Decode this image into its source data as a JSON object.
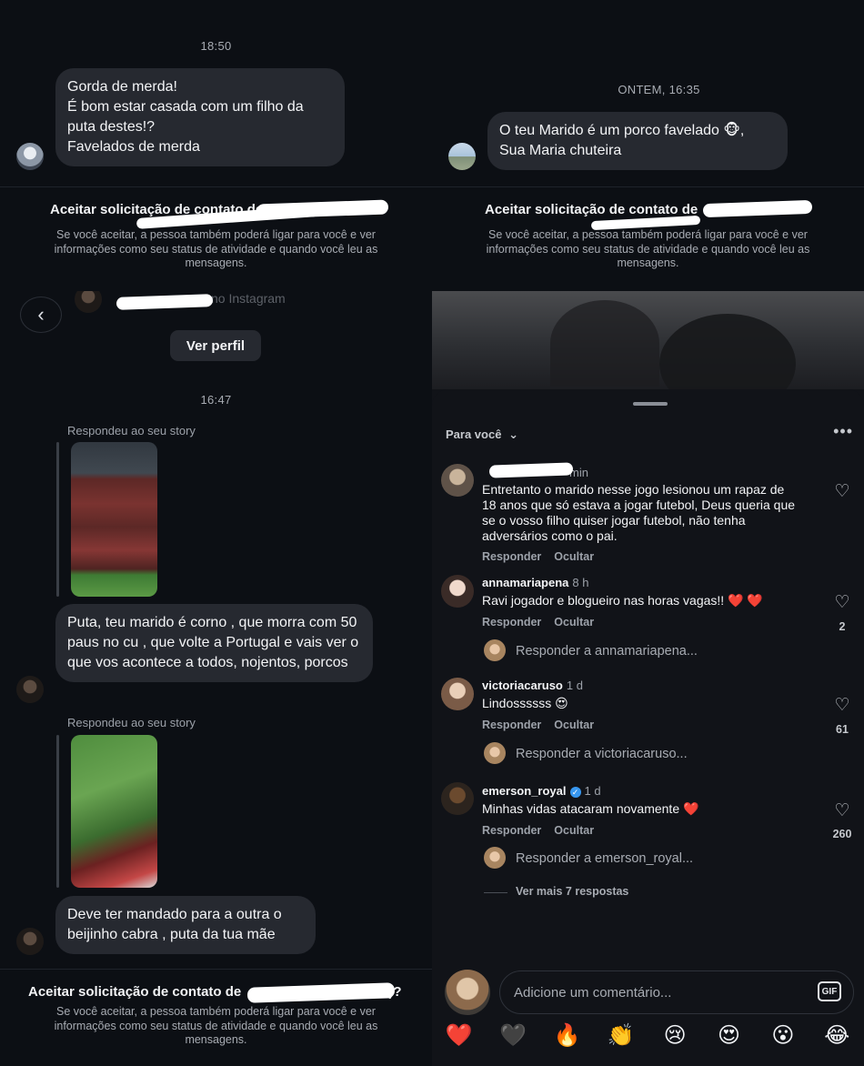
{
  "panel1": {
    "timestamp": "18:50",
    "message": "Gorda de merda!\nÉ bom estar casada  com um filho da puta destes!?\nFavelados de merda",
    "accept_title": "Aceitar solicitação de contato de",
    "accept_text": "Se você aceitar, a pessoa também poderá ligar para você e ver informações como seu status de atividade e quando você leu as mensagens."
  },
  "panel2": {
    "timestamp": "ONTEM, 16:35",
    "message": "O teu Marido é um porco favelado 🐵,\nSua Maria chuteira",
    "accept_title": "Aceitar solicitação de contato de",
    "accept_text": "Se você aceitar, a pessoa também poderá ligar para você e ver informações como seu status de atividade e quando você leu as mensagens."
  },
  "panel3": {
    "header_sub": "no Instagram",
    "view_profile": "Ver perfil",
    "timestamp": "16:47",
    "reply_label_1": "Respondeu ao seu story",
    "message_1": "Puta, teu marido é corno , que morra com 50 paus no cu , que volte a Portugal e vais ver o que vos acontece a todos, nojentos, porcos",
    "reply_label_2": "Respondeu ao seu story",
    "message_2": "Deve ter mandado para a outra o beijinho cabra , puta da tua mãe",
    "accept_title": "Aceitar solicitação de contato de",
    "accept_title_end": "l)?",
    "accept_text": "Se você aceitar, a pessoa também poderá ligar para você e ver informações como seu status de atividade e quando você leu as mensagens."
  },
  "panel4": {
    "filter": "Para você",
    "comments": [
      {
        "user": "",
        "time": "min",
        "text": "Entretanto o marido nesse jogo lesionou um rapaz de 18 anos que só estava a jogar futebol, Deus queria que se o vosso filho quiser jogar futebol, não tenha adversários como o pai.",
        "reply": "Responder",
        "hide": "Ocultar",
        "likes": ""
      },
      {
        "user": "annamariapena",
        "time": "8 h",
        "text": "Ravi jogador e blogueiro nas horas vagas!! ❤️ ❤️",
        "reply": "Responder",
        "hide": "Ocultar",
        "likes": "2",
        "reply_to": "Responder a annamariapena..."
      },
      {
        "user": "victoriacaruso",
        "time": "1 d",
        "text": "Lindossssss 😍",
        "reply": "Responder",
        "hide": "Ocultar",
        "likes": "61",
        "reply_to": "Responder a victoriacaruso..."
      },
      {
        "user": "emerson_royal",
        "time": "1 d",
        "verified": true,
        "text": "Minhas vidas atacaram novamente ❤️",
        "reply": "Responder",
        "hide": "Ocultar",
        "likes": "260",
        "reply_to": "Responder a emerson_royal...",
        "more_replies": "Ver mais 7 respostas"
      }
    ],
    "emojis": [
      "❤️",
      "🖤",
      "🔥",
      "👏",
      "😢",
      "😍",
      "😮",
      "😂"
    ],
    "comment_placeholder": "Adicione um comentário...",
    "gif_label": "GIF"
  },
  "colors": {
    "background": "#0c0f14",
    "bubble": "#262930",
    "muted_text": "#a8acb3",
    "verified_blue": "#3797f0"
  }
}
